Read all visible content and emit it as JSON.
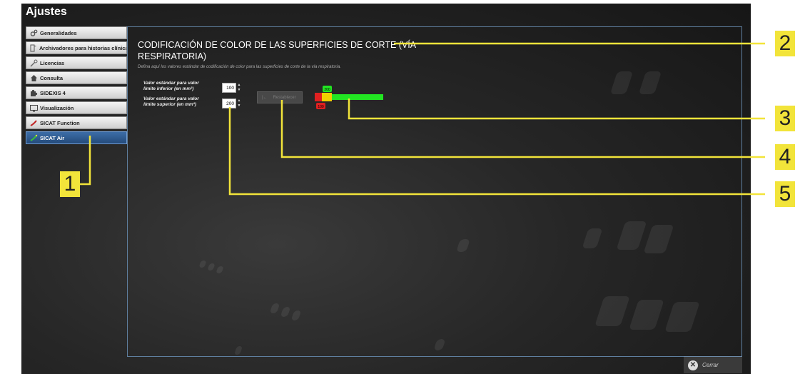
{
  "window": {
    "title": "Ajustes"
  },
  "sidebar": {
    "items": [
      {
        "label": "Generalidades",
        "icon": "gears-icon"
      },
      {
        "label": "Archivadores para historias clínicas",
        "icon": "folder-icon"
      },
      {
        "label": "Licencias",
        "icon": "key-icon"
      },
      {
        "label": "Consulta",
        "icon": "house-icon"
      },
      {
        "label": "SIDEXIS 4",
        "icon": "puzzle-icon"
      },
      {
        "label": "Visualización",
        "icon": "monitor-icon"
      },
      {
        "label": "SICAT Function",
        "icon": "sicat-function-icon"
      },
      {
        "label": "SICAT Air",
        "icon": "sicat-air-icon",
        "active": true
      }
    ]
  },
  "panel": {
    "title": "CODIFICACIÓN DE COLOR DE LAS SUPERFICIES DE CORTE (VÍA RESPIRATORIA)",
    "description": "Defina aquí los valores estándar de codificación de color para las superficies de corte de la vía respiratoria.",
    "lower_label": "Valor estándar para valor límite inferior (en mm²)",
    "lower_value": "100",
    "upper_label": "Valor estándar para valor límite superior (en mm²)",
    "upper_value": "200",
    "reset_label": "Restablecer",
    "scale": {
      "lower_marker": "100",
      "upper_marker": "200",
      "low_color": "#e02020",
      "mid_color": "#f0d000",
      "high_color": "#22e622"
    }
  },
  "footer": {
    "close_label": "Cerrar"
  },
  "callouts": [
    "1",
    "2",
    "3",
    "4",
    "5"
  ],
  "colors": {
    "accent": "#f2e43a",
    "active_item": "#2f5c92",
    "panel_border": "#5f7f9f"
  }
}
